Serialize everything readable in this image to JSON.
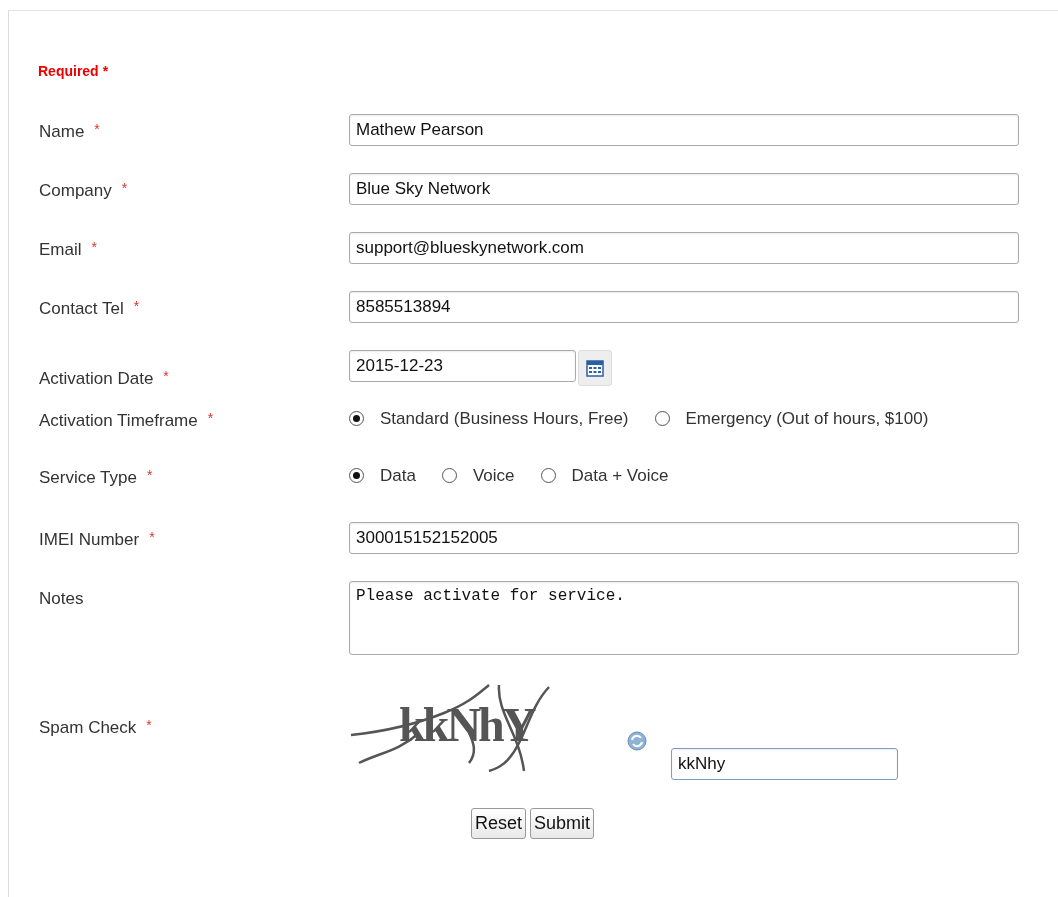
{
  "required_note": {
    "text": "Required",
    "mark": "*"
  },
  "fields": [
    {
      "kind": "text",
      "label": "Name",
      "required": true,
      "value": "Mathew Pearson"
    },
    {
      "kind": "text",
      "label": "Company",
      "required": true,
      "value": "Blue Sky Network"
    },
    {
      "kind": "text",
      "label": "Email",
      "required": true,
      "value": "support@blueskynetwork.com"
    },
    {
      "kind": "text",
      "label": "Contact Tel",
      "required": true,
      "value": "8585513894"
    },
    {
      "kind": "date",
      "label": "Activation Date",
      "required": true,
      "value": "2015-12-23"
    },
    {
      "kind": "radio",
      "label": "Activation Timeframe",
      "required": true,
      "options": [
        {
          "label": "Standard (Business Hours, Free)",
          "selected": true
        },
        {
          "label": "Emergency (Out of hours, $100)",
          "selected": false
        }
      ]
    },
    {
      "kind": "radio",
      "label": "Service Type",
      "required": true,
      "options": [
        {
          "label": "Data",
          "selected": true
        },
        {
          "label": "Voice",
          "selected": false
        },
        {
          "label": "Data + Voice",
          "selected": false
        }
      ]
    },
    {
      "kind": "text",
      "label": "IMEI Number",
      "required": true,
      "value": "300015152152005"
    },
    {
      "kind": "textarea",
      "label": "Notes",
      "required": false,
      "value": "Please activate for service."
    },
    {
      "kind": "captcha",
      "label": "Spam Check",
      "required": true,
      "captcha_text": "kkNhY",
      "value": "kkNhy"
    }
  ],
  "buttons": [
    "Reset",
    "Submit"
  ]
}
